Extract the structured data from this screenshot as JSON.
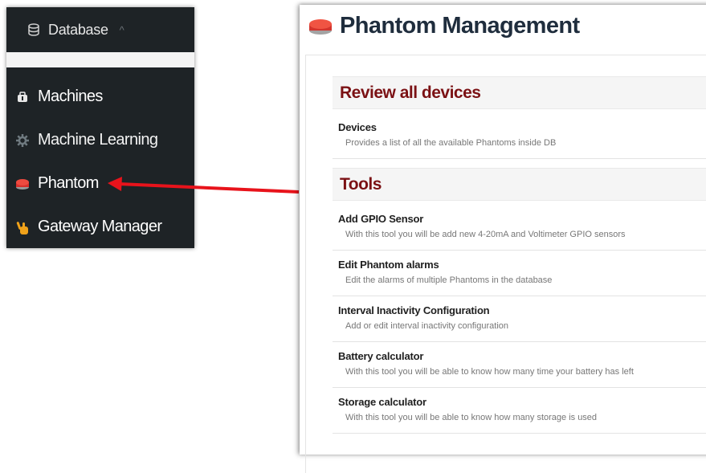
{
  "sidebar": {
    "header": {
      "label": "Database",
      "icon": "database-icon",
      "chevron": "^"
    },
    "items": [
      {
        "label": "Machines",
        "icon": "machines-icon"
      },
      {
        "label": "Machine Learning",
        "icon": "gear-icon"
      },
      {
        "label": "Phantom",
        "icon": "red-button-icon"
      },
      {
        "label": "Gateway Manager",
        "icon": "hand-icon"
      }
    ]
  },
  "panel": {
    "title": "Phantom Management",
    "sections": [
      {
        "heading": "Review all devices",
        "entries": [
          {
            "title": "Devices",
            "desc": "Provides a list of all the available Phantoms inside DB"
          }
        ]
      },
      {
        "heading": "Tools",
        "entries": [
          {
            "title": "Add GPIO Sensor",
            "desc": "With this tool you will be add new 4-20mA and Voltimeter GPIO sensors"
          },
          {
            "title": "Edit Phantom alarms",
            "desc": "Edit the alarms of multiple Phantoms in the database"
          },
          {
            "title": "Interval Inactivity Configuration",
            "desc": "Add or edit interval inactivity configuration"
          },
          {
            "title": "Battery calculator",
            "desc": "With this tool you will be able to know how many time your battery has left"
          },
          {
            "title": "Storage calculator",
            "desc": "With this tool you will be able to know how many storage is used"
          }
        ]
      }
    ]
  },
  "colors": {
    "sidebar_bg": "#1e2326",
    "heading_red": "#7b1114",
    "arrow": "#e8131b"
  }
}
